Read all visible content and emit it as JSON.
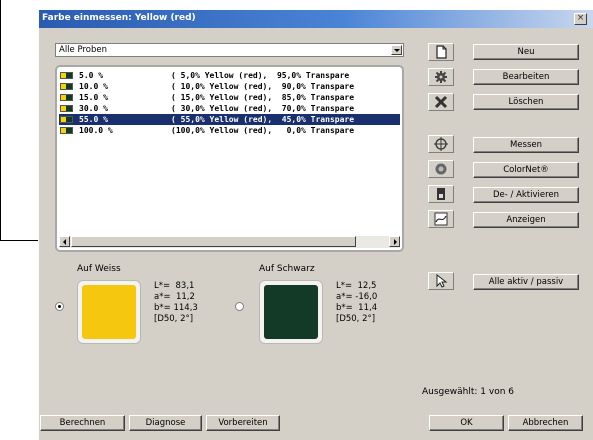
{
  "window": {
    "title": "Farbe einmessen: Yellow (red)",
    "close_glyph": "×"
  },
  "filter": {
    "value": "Alle Proben"
  },
  "samples": [
    {
      "pct": "5.0 %",
      "desc": "( 5,0% Yellow (red),  95,0% Transpare",
      "swatch_left": "#f5d20a",
      "swatch_right": "#123a22",
      "selected": false
    },
    {
      "pct": "10.0 %",
      "desc": "( 10,0% Yellow (red),  90,0% Transpare",
      "swatch_left": "#f5d20a",
      "swatch_right": "#123a22",
      "selected": false
    },
    {
      "pct": "15.0 %",
      "desc": "( 15,0% Yellow (red),  85,0% Transpare",
      "swatch_left": "#f5d20a",
      "swatch_right": "#123a22",
      "selected": false
    },
    {
      "pct": "30.0 %",
      "desc": "( 30,0% Yellow (red),  70,0% Transpare",
      "swatch_left": "#f5d20a",
      "swatch_right": "#123a22",
      "selected": false
    },
    {
      "pct": "55.0 %",
      "desc": "( 55,0% Yellow (red),  45,0% Transpare",
      "swatch_left": "#f5d20a",
      "swatch_right": "#123a22",
      "selected": true
    },
    {
      "pct": "100.0 %",
      "desc": "(100,0% Yellow (red),   0,0% Transpare",
      "swatch_left": "#f5d20a",
      "swatch_right": "#123a22",
      "selected": false
    }
  ],
  "on_white": {
    "label": "Auf Weiss",
    "color": "#f5c70e",
    "lab": "L*=  83,1\na*=  11,2\nb*= 114,3\n[D50, 2°]",
    "selected": true
  },
  "on_black": {
    "label": "Auf Schwarz",
    "color": "#123a26",
    "lab": "L*=  12,5\na*= -16,0\nb*=  11,4\n[D50, 2°]",
    "selected": false
  },
  "tools": [
    {
      "label": "Neu",
      "icon": "new-document-icon"
    },
    {
      "label": "Bearbeiten",
      "icon": "gear-icon"
    },
    {
      "label": "Löschen",
      "icon": "delete-x-icon"
    },
    {
      "label": "Messen",
      "icon": "crosshair-icon"
    },
    {
      "label": "ColorNet®",
      "icon": "colornet-icon"
    },
    {
      "label": "De- / Aktivieren",
      "icon": "toggle-icon"
    },
    {
      "label": "Anzeigen",
      "icon": "curve-chart-icon"
    },
    {
      "label": "Alle aktiv / passiv",
      "icon": "cursor-icon"
    }
  ],
  "status": {
    "selection": "Ausgewählt: 1 von 6"
  },
  "footer": {
    "berechnen": "Berechnen",
    "diagnose": "Diagnose",
    "vorbereiten": "Vorbereiten",
    "ok": "OK",
    "abbrechen": "Abbrechen"
  },
  "colors": {
    "selection": "#1a2f6e",
    "title_start": "#2a5bb0",
    "title_end": "#c9d7ee",
    "dialog_bg": "#d4d0c8"
  }
}
